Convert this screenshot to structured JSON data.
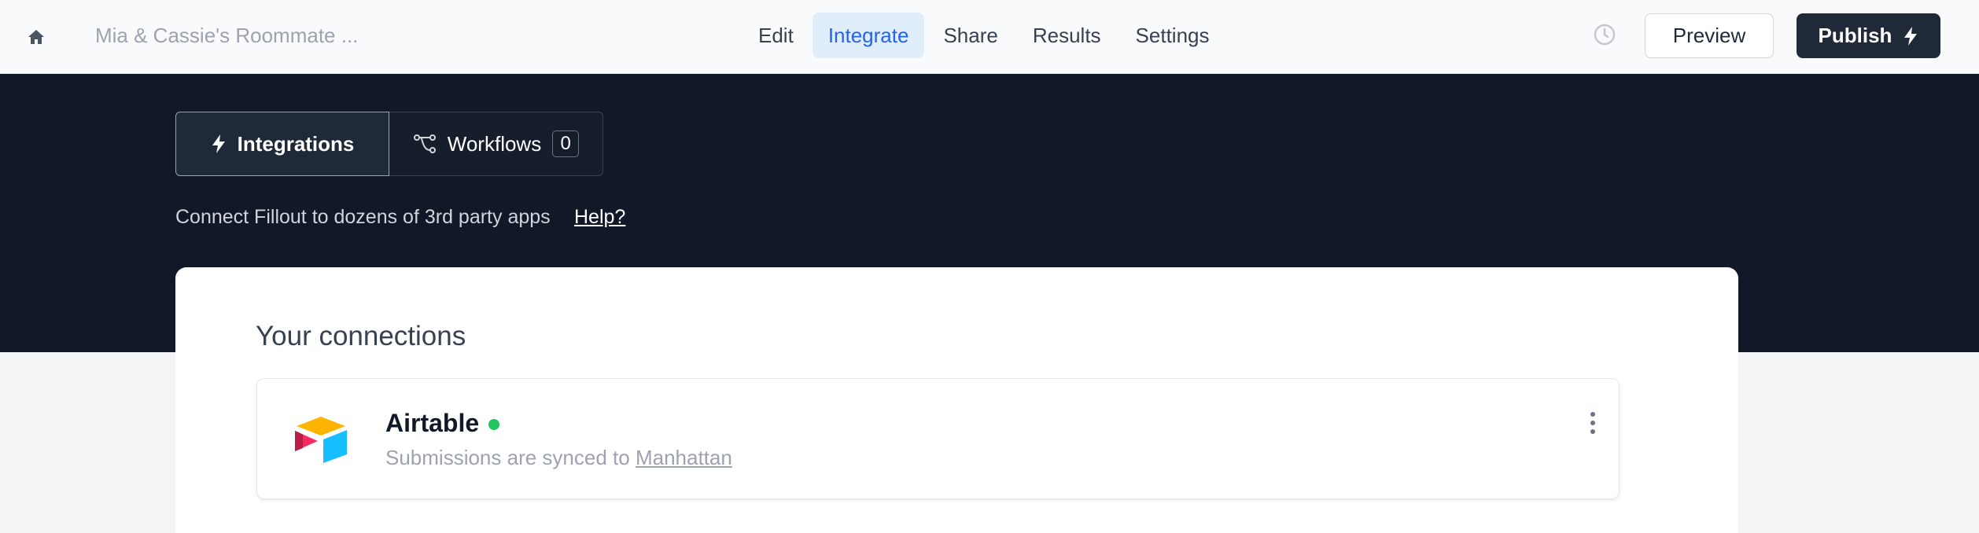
{
  "header": {
    "form_title": "Mia & Cassie's Roommate ...",
    "tabs": [
      {
        "label": "Edit",
        "active": false
      },
      {
        "label": "Integrate",
        "active": true
      },
      {
        "label": "Share",
        "active": false
      },
      {
        "label": "Results",
        "active": false
      },
      {
        "label": "Settings",
        "active": false
      }
    ],
    "preview_label": "Preview",
    "publish_label": "Publish"
  },
  "hero": {
    "segments": {
      "integrations_label": "Integrations",
      "workflows_label": "Workflows",
      "workflows_count": "0"
    },
    "subtitle": "Connect Fillout to dozens of 3rd party apps",
    "help_label": "Help?"
  },
  "connections": {
    "title": "Your connections",
    "items": [
      {
        "name": "Airtable",
        "status": "connected",
        "description_prefix": "Submissions are synced to",
        "link_label": "Manhattan"
      }
    ]
  },
  "colors": {
    "accent": "#2563eb",
    "hero_bg": "#111827",
    "status_green": "#22c55e"
  },
  "icons": [
    "home-icon",
    "history-icon",
    "lightning-icon",
    "workflow-icon",
    "airtable-logo",
    "more-vertical-icon"
  ]
}
